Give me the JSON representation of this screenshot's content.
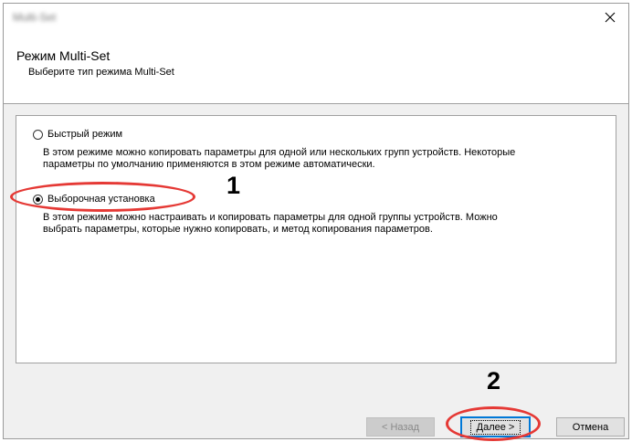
{
  "window": {
    "title": "Multi-Set"
  },
  "header": {
    "title": "Режим Multi-Set",
    "subtitle": "Выберите тип режима Multi-Set"
  },
  "options": [
    {
      "label": "Быстрый режим",
      "checked": false,
      "description_lines": [
        "В этом режиме можно копировать параметры для одной или нескольких групп устройств. Некоторые",
        "параметры по умолчанию применяются в этом режиме автоматически."
      ]
    },
    {
      "label": "Выборочная установка",
      "checked": true,
      "description_lines": [
        "В этом режиме можно настраивать и копировать параметры для одной группы устройств. Можно",
        "выбрать параметры, которые нужно копировать, и метод копирования параметров."
      ]
    }
  ],
  "annotations": {
    "step1": "1",
    "step2": "2",
    "color": "#e53935"
  },
  "buttons": {
    "back": "< Назад",
    "next": "Далее >",
    "cancel": "Отмена"
  }
}
